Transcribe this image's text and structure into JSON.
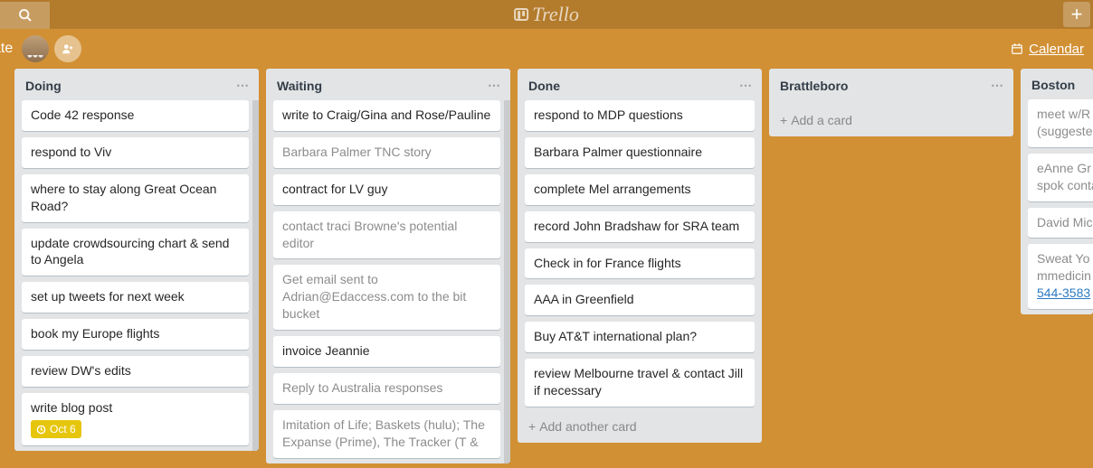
{
  "brand": "Trello",
  "subbar": {
    "leftTruncated": "ate",
    "calendar": "Calendar"
  },
  "lists": [
    {
      "title": "Doing",
      "scroll": true,
      "cards": [
        {
          "text": "Code 42 response"
        },
        {
          "text": "respond to Viv"
        },
        {
          "text": "where to stay along Great Ocean Road?"
        },
        {
          "text": "update crowdsourcing chart & send to Angela"
        },
        {
          "text": "set up tweets for next week"
        },
        {
          "text": "book my Europe flights"
        },
        {
          "text": "review DW's edits"
        },
        {
          "text": "write blog post",
          "badge": "Oct 6"
        }
      ]
    },
    {
      "title": "Waiting",
      "scroll": true,
      "cards": [
        {
          "text": "write to Craig/Gina and Rose/Pauline"
        },
        {
          "text": "Barbara Palmer TNC story",
          "dim": true
        },
        {
          "text": "contract for LV guy"
        },
        {
          "text": "contact traci Browne's potential editor",
          "dim": true
        },
        {
          "text": "Get email sent to Adrian@Edaccess.com to the bit bucket",
          "dim": true
        },
        {
          "text": "invoice Jeannie"
        },
        {
          "text": "Reply to Australia responses",
          "dim": true
        },
        {
          "text": "Imitation of Life; Baskets (hulu); The Expanse (Prime), The Tracker (T &",
          "dim": true
        }
      ]
    },
    {
      "title": "Done",
      "addLabel": "Add another card",
      "cards": [
        {
          "text": "respond to MDP questions"
        },
        {
          "text": "Barbara Palmer questionnaire"
        },
        {
          "text": "complete Mel arrangements"
        },
        {
          "text": "record John Bradshaw for SRA team"
        },
        {
          "text": "Check in for France flights"
        },
        {
          "text": "AAA in Greenfield"
        },
        {
          "text": "Buy AT&T international plan?"
        },
        {
          "text": "review Melbourne travel & contact Jill if necessary"
        }
      ]
    },
    {
      "title": "Brattleboro",
      "addLabel": "Add a card",
      "cards": []
    },
    {
      "title": "Boston",
      "truncated": true,
      "cards": [
        {
          "text": "meet w/R Groton, M Thalheime (suggeste",
          "dim": true
        },
        {
          "text": "eAnne Gr @ASegar @eventsfo have spok contact m town.",
          "dim": true
        },
        {
          "text": "David Mic",
          "dim": true
        },
        {
          "text": "Sweat Yo Street Co http://ww mmedicin",
          "dim": true,
          "link": "544-3583"
        }
      ]
    }
  ]
}
